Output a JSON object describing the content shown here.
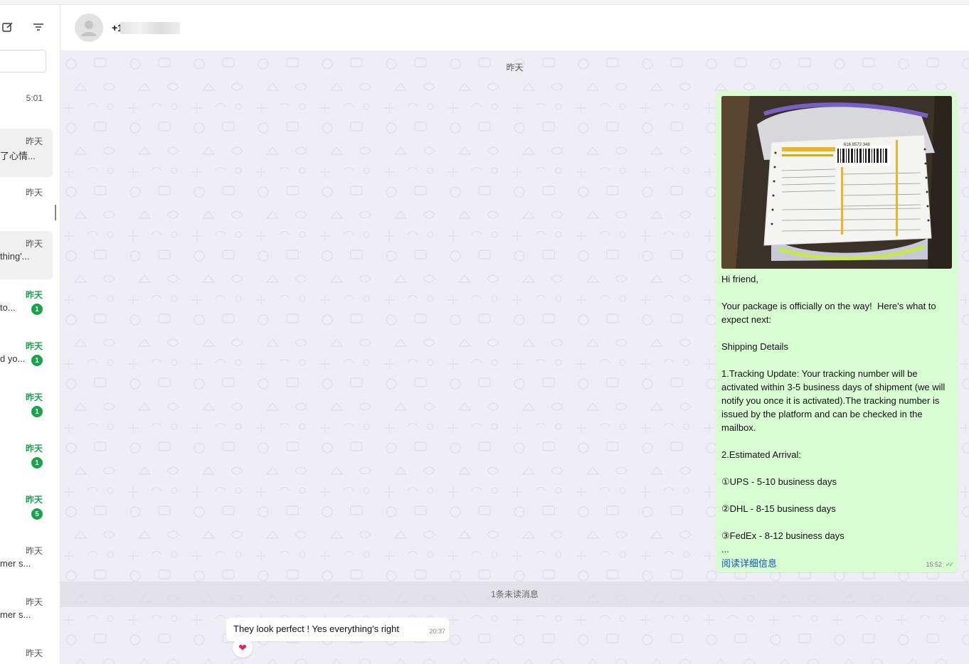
{
  "sidebar": {
    "compose_icon": "compose-icon",
    "filter_icon": "filter-icon",
    "chats": [
      {
        "time": "5:01",
        "preview": "",
        "badge": ""
      },
      {
        "time": "昨天",
        "preview": "了心情...",
        "badge": ""
      },
      {
        "time": "昨天",
        "preview": "",
        "badge": ""
      },
      {
        "time": "昨天",
        "preview": "thing'...",
        "badge": ""
      },
      {
        "time": "昨天",
        "preview": "to...",
        "badge": "1"
      },
      {
        "time": "昨天",
        "preview": "d yo...",
        "badge": "1"
      },
      {
        "time": "昨天",
        "preview": "",
        "badge": "1"
      },
      {
        "time": "昨天",
        "preview": "",
        "badge": "1"
      },
      {
        "time": "昨天",
        "preview": "",
        "badge": "5"
      },
      {
        "time": "昨天",
        "preview": "mer s...",
        "badge": ""
      },
      {
        "time": "昨天",
        "preview": "mer s...",
        "badge": ""
      },
      {
        "time": "昨天",
        "preview": "",
        "badge": ""
      }
    ]
  },
  "header": {
    "contact_name": "+1",
    "avatar_icon": "person-icon"
  },
  "chat": {
    "date_separator": "昨天",
    "outgoing": {
      "text": "Hi friend,\n\nYour package is officially on the way!  Here's what to expect next:\n\nShipping Details\n\n1.Tracking Update: Your tracking number will be activated within 3-5 business days of shipment (we will notify you once it is activated).The tracking number is issued by the platform and can be checked in the mailbox.\n\n2.Estimated Arrival:\n\n①UPS - 5-10 business days\n\n②DHL - 8-15 business days\n\n③FedEx - 8-12 business days\n...",
      "read_more": "阅读详细信息",
      "time": "15:52",
      "ticks": "✓✓",
      "photo_label_number": "616 8572 348"
    },
    "unread_separator": "1条未读消息",
    "incoming": {
      "text": "They look perfect ! Yes everything's right",
      "time": "20:37",
      "reaction": "❤"
    }
  },
  "colors": {
    "unread_green": "#1aa34a",
    "outgoing_bubble": "#d9fdd3",
    "link_blue": "#0b59b3",
    "chat_background": "#efedf6"
  }
}
